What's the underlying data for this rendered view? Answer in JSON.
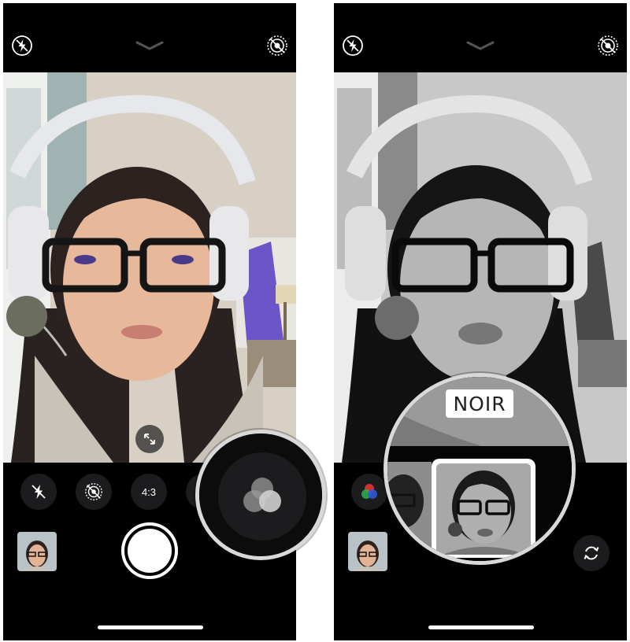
{
  "left_screen": {
    "controls": {
      "aspect_ratio_label": "4:3"
    }
  },
  "right_screen": {
    "filter_name": "NOIR"
  },
  "icons": {
    "flash": "flash-off-icon",
    "live_photo": "live-photo-off-icon",
    "top_chevron": "chevron-down-icon",
    "filters": "filters-icon",
    "switch_camera": "camera-flip-icon",
    "expand": "expand-arrows-icon"
  },
  "colors": {
    "background": "#000000",
    "control_bg": "#1c1c1e",
    "wall_color": "#d8d0c4",
    "tapestry_purple": "#6b55c8",
    "zoom_ring": "#d9d9d9",
    "filter_red": "#e8322e",
    "filter_green": "#2fb34a",
    "filter_blue": "#2f5be0"
  }
}
